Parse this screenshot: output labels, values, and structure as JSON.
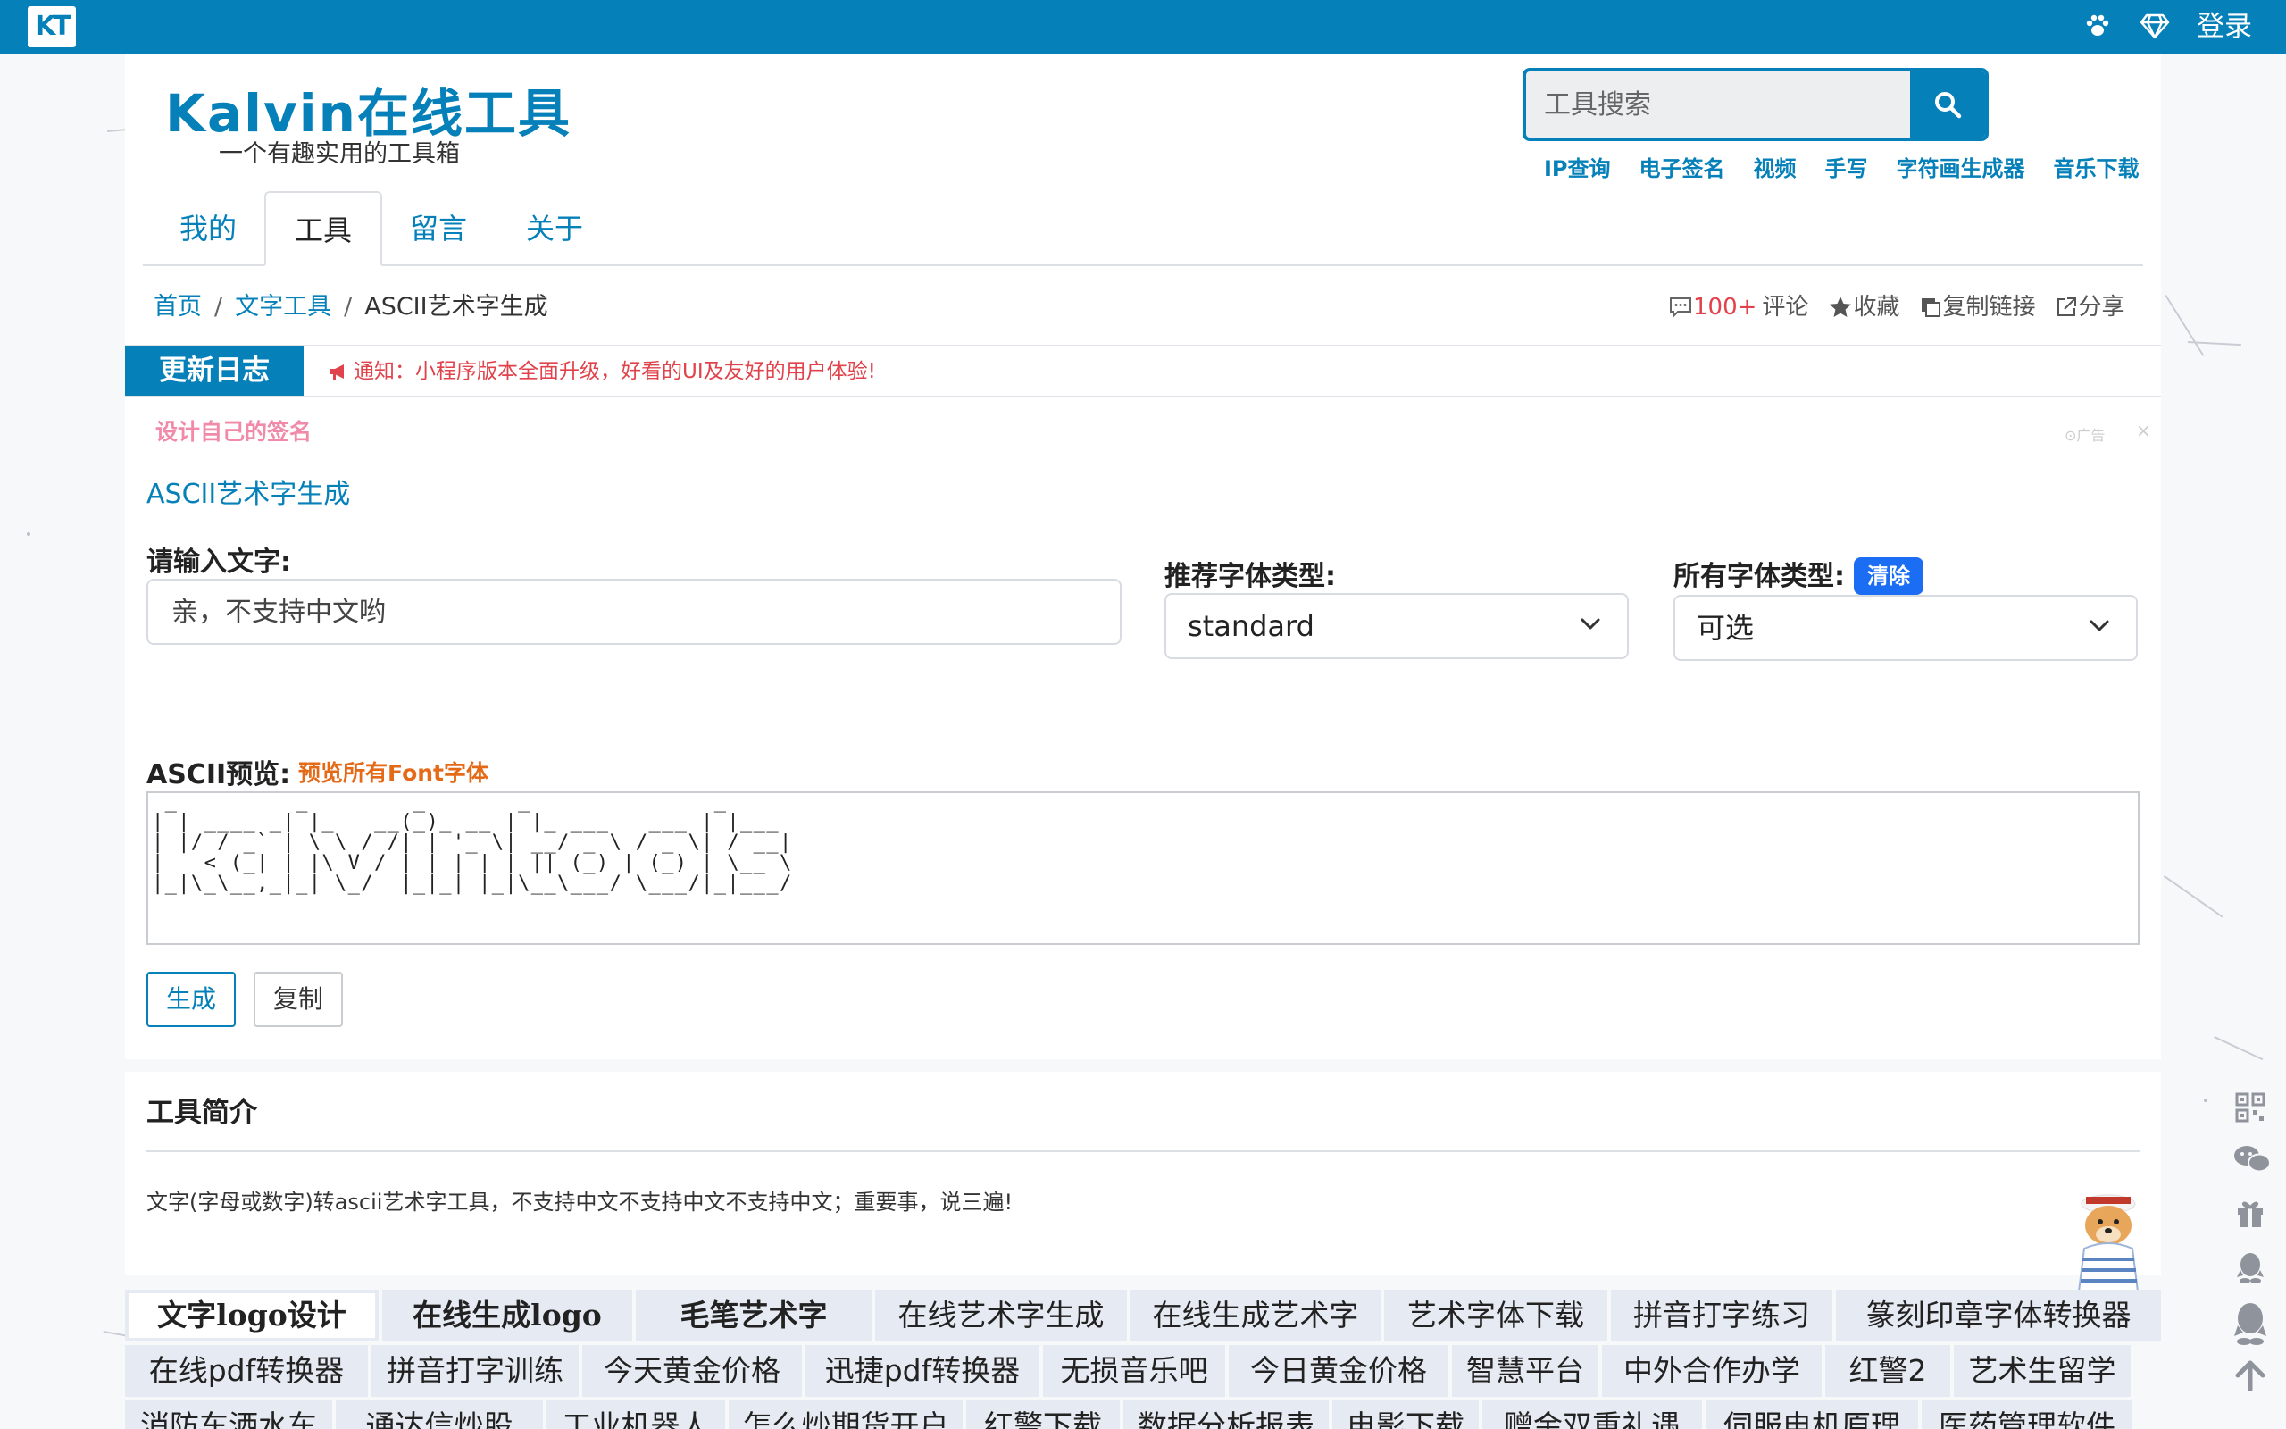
{
  "topbar": {
    "logo": "KT",
    "paw_icon": "paw-icon",
    "diamond_icon": "diamond-icon",
    "login": "登录"
  },
  "header": {
    "brand": "Kalvin在线工具",
    "slogan": "一个有趣实用的工具箱",
    "search_placeholder": "工具搜索",
    "quick_links": [
      "IP查询",
      "电子签名",
      "视频",
      "手写",
      "字符画生成器",
      "音乐下载"
    ]
  },
  "tabs": [
    "我的",
    "工具",
    "留言",
    "关于"
  ],
  "active_tab": "工具",
  "breadcrumb": {
    "home": "首页",
    "category": "文字工具",
    "current": "ASCII艺术字生成"
  },
  "actions": {
    "comments_count": "100+",
    "comments_label": "评论",
    "favorite": "收藏",
    "copy_link": "复制链接",
    "share": "分享"
  },
  "notice": {
    "update_log": "更新日志",
    "text": "通知：小程序版本全面升级，好看的UI及友好的用户体验!"
  },
  "ad": {
    "title": "设计自己的签名",
    "mark": "广告",
    "close": "×"
  },
  "tool": {
    "title": "ASCII艺术字生成",
    "input_label": "请输入文字:",
    "input_placeholder": "亲，不支持中文哟",
    "recommended_font_label": "推荐字体类型:",
    "recommended_font_value": "standard",
    "all_fonts_label": "所有字体类型:",
    "clear_button": "清除",
    "all_fonts_value": "可选",
    "preview_label": "ASCII预览:",
    "preview_all_link": "预览所有Font字体",
    "ascii_output": " _         _        _       _              _       \n| | ____ _| |_   __(_)_ __ | |_ ___   ___ | |___   \n| |/ / _` | \\ \\ / /| | '_ \\| __/ _ \\ / _ \\| / __|  \n|   < (_| | |\\ V / | | | | | || (_) | (_) | \\__ \\  \n|_|\\_\\__,_|_| \\_/  |_|_| |_|\\__\\___/ \\___/|_|___/  ",
    "generate_button": "生成",
    "copy_button": "复制"
  },
  "intro": {
    "title": "工具简介",
    "text": "文字(字母或数字)转ascii艺术字工具，不支持中文不支持中文不支持中文；重要事，说三遍!"
  },
  "link_rows": [
    [
      "文字logo设计",
      "在线生成logo",
      "毛笔艺术字",
      "在线艺术字生成",
      "在线生成艺术字",
      "艺术字体下载",
      "拼音打字练习",
      "篆刻印章字体转换器"
    ],
    [
      "在线pdf转换器",
      "拼音打字训练",
      "今天黄金价格",
      "迅捷pdf转换器",
      "无损音乐吧",
      "今日黄金价格",
      "智慧平台",
      "中外合作办学",
      "红警2",
      "艺术生留学"
    ],
    [
      "消防车洒水车",
      "通达信炒股",
      "工业机器人",
      "怎么炒期货开户",
      "红警下载",
      "数据分析报表",
      "电影下载",
      "赠金双重礼遇",
      "伺服电机原理",
      "医药管理软件"
    ]
  ],
  "float_icons": [
    "qrcode-icon",
    "wechat-icon",
    "gift-icon",
    "qq-icon",
    "qq-group-icon",
    "arrow-up-icon"
  ]
}
